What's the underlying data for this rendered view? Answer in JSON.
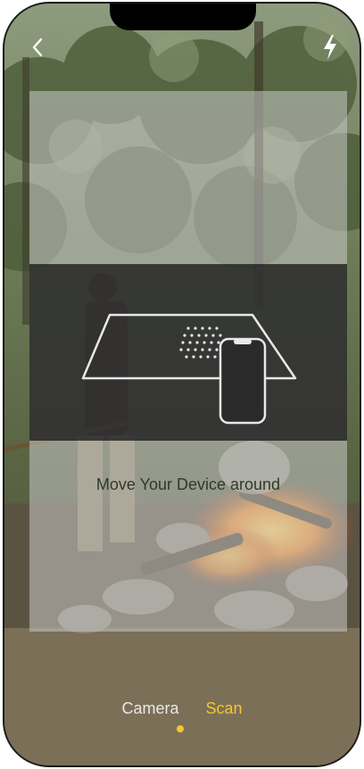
{
  "topbar": {
    "back_icon": "chevron-left-icon",
    "flash_icon": "lightning-bolt-icon"
  },
  "instruction": {
    "text": "Move Your Device around"
  },
  "modes": {
    "items": [
      {
        "label": "Camera",
        "selected": false
      },
      {
        "label": "Scan",
        "selected": true
      }
    ]
  },
  "colors": {
    "accent": "#f2c82d",
    "mode_inactive": "#e8e8e8"
  }
}
